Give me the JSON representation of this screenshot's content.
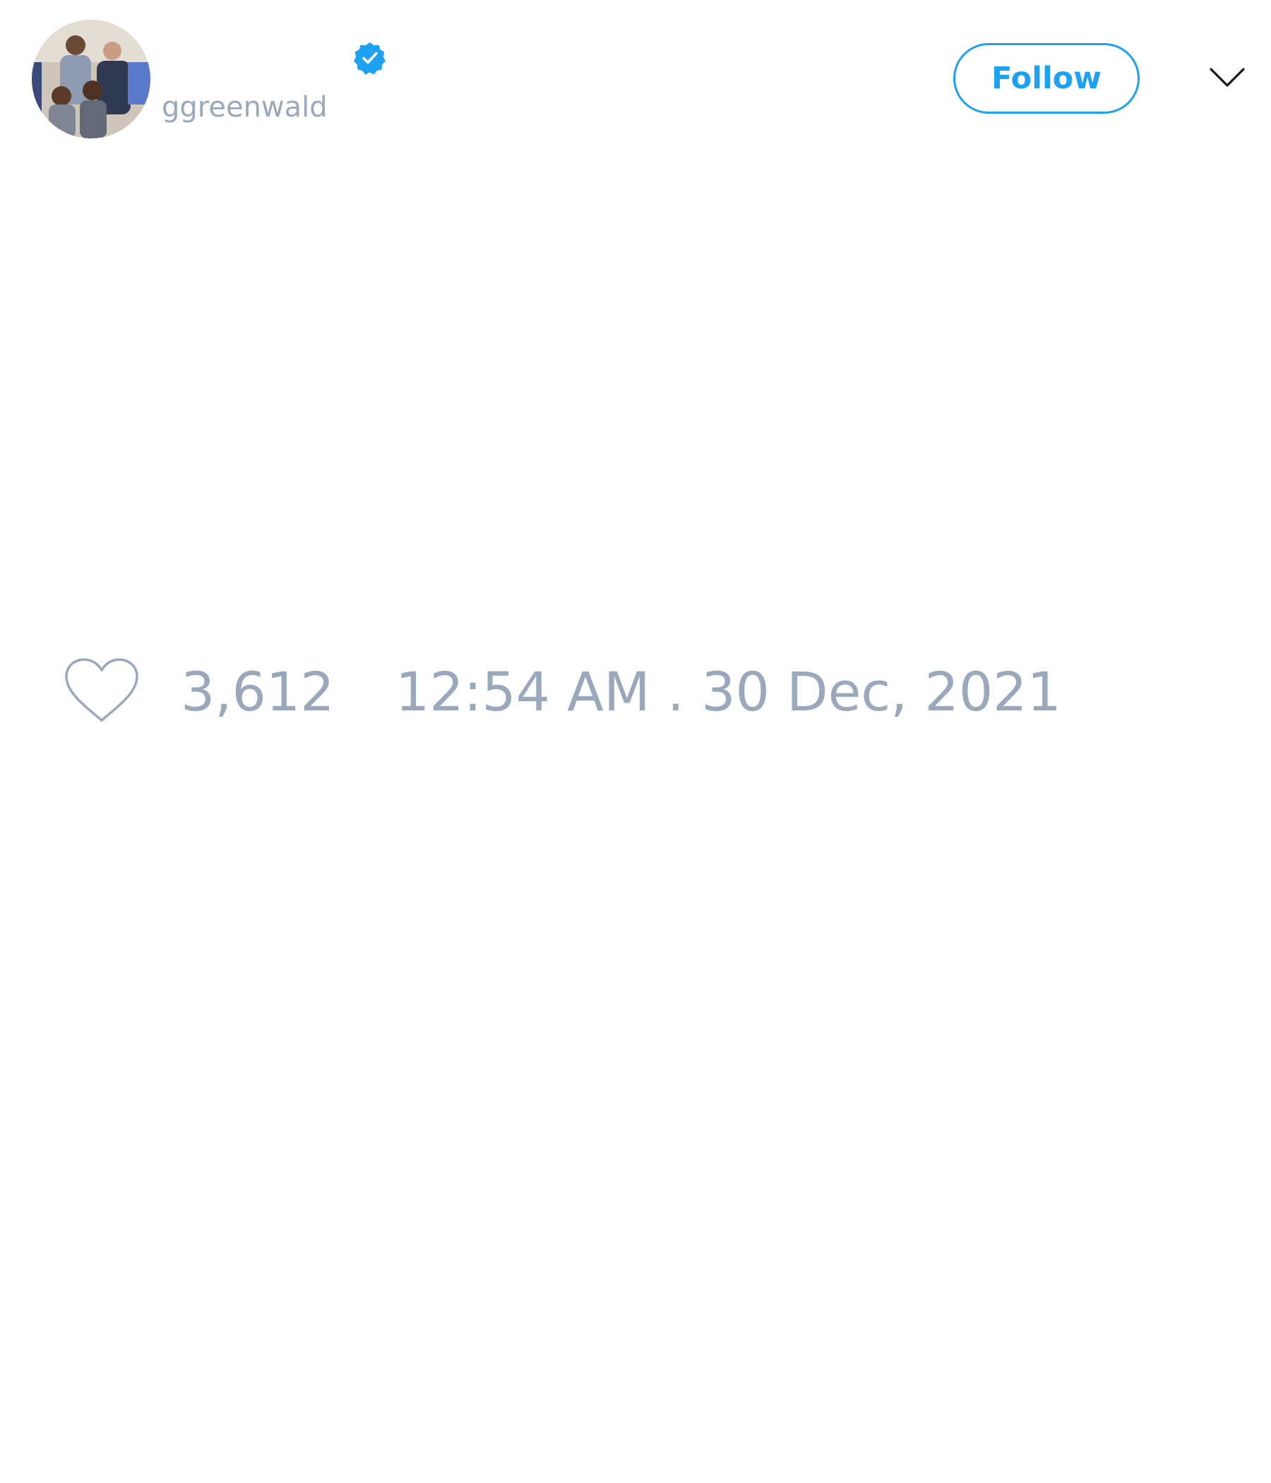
{
  "tweet": {
    "author": {
      "display_name": "",
      "handle": "ggreenwald",
      "verified_icon": "verified-badge-icon",
      "avatar": "family-photo-avatar"
    },
    "follow_label": "Follow",
    "menu_icon": "chevron-down-icon",
    "likes": {
      "icon": "heart-icon",
      "count": "3,612"
    },
    "timestamp": "12:54 AM . 30 Dec, 2021"
  },
  "colors": {
    "accent": "#1da1f2",
    "muted_text": "#9aa8bb",
    "background": "#ffffff"
  }
}
